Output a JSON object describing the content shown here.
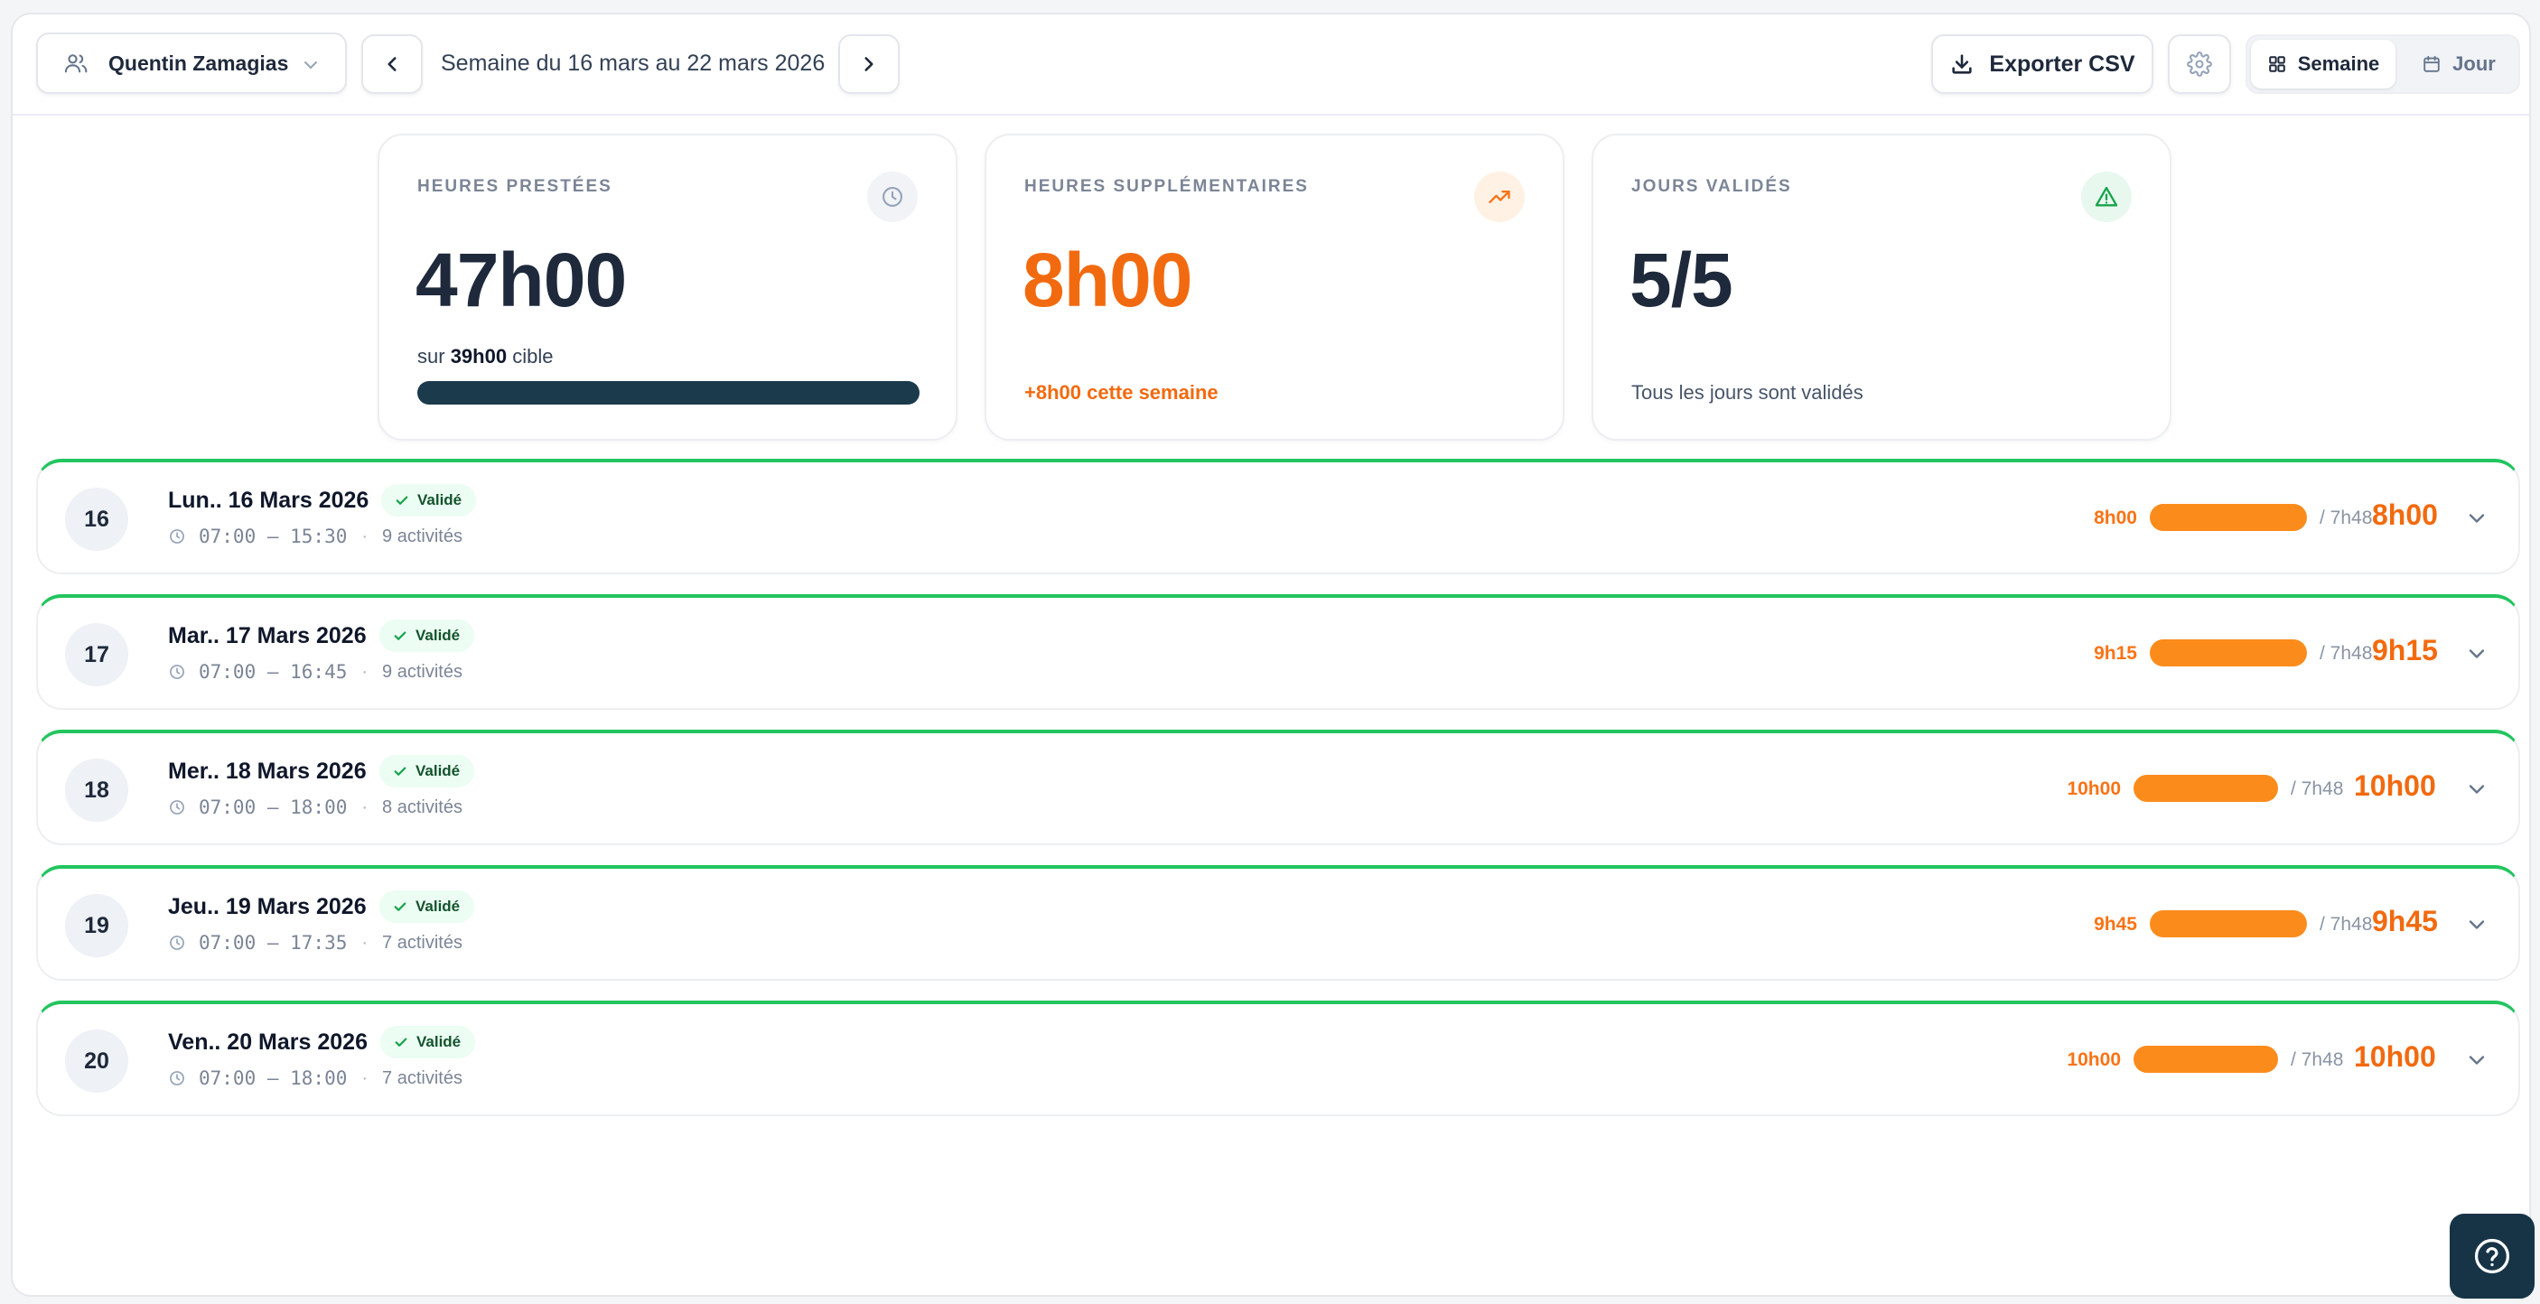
{
  "toolbar": {
    "user_label": "Quentin Zamagias",
    "week_label": "Semaine du 16 mars au 22 mars 2026",
    "export_label": "Exporter CSV",
    "view_week_label": "Semaine",
    "view_day_label": "Jour"
  },
  "stats": {
    "hours_worked": {
      "title": "HEURES PRESTÉES",
      "value": "47h00",
      "sub_prefix": "sur",
      "sub_target": "39h00",
      "sub_suffix": "cible",
      "progress": 1.0
    },
    "overtime": {
      "title": "HEURES SUPPLÉMENTAIRES",
      "value": "8h00",
      "note": "+8h00 cette semaine"
    },
    "validated_days": {
      "title": "JOURS VALIDÉS",
      "value": "5/5",
      "note": "Tous les jours sont validés"
    }
  },
  "colors": {
    "accent_orange": "#f26a0f",
    "bar_orange": "#fb8c1c",
    "dark_navy": "#1b3a4b",
    "validated_green": "#22c55e"
  },
  "days": [
    {
      "num": "16",
      "title": "Lun.. 16 Mars 2026",
      "badge": "Validé",
      "time": "07:00 — 15:30",
      "activities": "9 activités",
      "hours_small": "8h00",
      "target": "/ 7h48",
      "hours_big": "8h00"
    },
    {
      "num": "17",
      "title": "Mar.. 17 Mars 2026",
      "badge": "Validé",
      "time": "07:00 — 16:45",
      "activities": "9 activités",
      "hours_small": "9h15",
      "target": "/ 7h48",
      "hours_big": "9h15"
    },
    {
      "num": "18",
      "title": "Mer.. 18 Mars 2026",
      "badge": "Validé",
      "time": "07:00 — 18:00",
      "activities": "8 activités",
      "hours_small": "10h00",
      "target": "/ 7h48",
      "hours_big": "10h00"
    },
    {
      "num": "19",
      "title": "Jeu.. 19 Mars 2026",
      "badge": "Validé",
      "time": "07:00 — 17:35",
      "activities": "7 activités",
      "hours_small": "9h45",
      "target": "/ 7h48",
      "hours_big": "9h45"
    },
    {
      "num": "20",
      "title": "Ven.. 20 Mars 2026",
      "badge": "Validé",
      "time": "07:00 — 18:00",
      "activities": "7 activités",
      "hours_small": "10h00",
      "target": "/ 7h48",
      "hours_big": "10h00"
    }
  ]
}
